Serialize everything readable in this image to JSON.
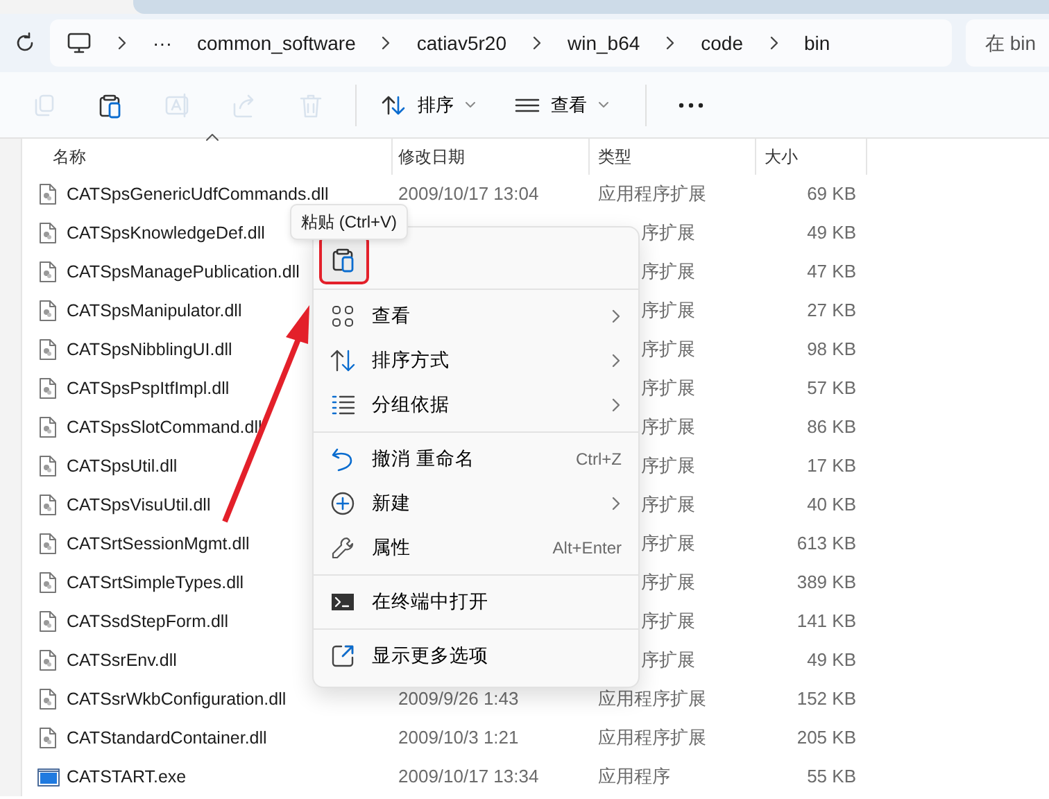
{
  "address_bar": {
    "overflow": "···",
    "segments": [
      "common_software",
      "catiav5r20",
      "win_b64",
      "code",
      "bin"
    ]
  },
  "search": {
    "placeholder": "在 bin"
  },
  "toolbar": {
    "icon_buttons": [
      {
        "kind": "copy",
        "disabled": true
      },
      {
        "kind": "paste",
        "disabled": false
      },
      {
        "kind": "rename",
        "disabled": true
      },
      {
        "kind": "share",
        "disabled": true
      },
      {
        "kind": "delete",
        "disabled": true
      }
    ],
    "sort": "排序",
    "view": "查看"
  },
  "columns": [
    {
      "label": "名称",
      "sorted": true
    },
    {
      "label": "修改日期",
      "sorted": false
    },
    {
      "label": "类型",
      "sorted": false
    },
    {
      "label": "大小",
      "sorted": false
    }
  ],
  "rows": [
    {
      "kind": "dll",
      "name": "CATSpsGenericUdfCommands.dll",
      "date": "2009/10/17 13:04",
      "type": "应用程序扩展",
      "size": "69 KB"
    },
    {
      "kind": "dll",
      "name": "CATSpsKnowledgeDef.dll",
      "type": "序扩展",
      "size": "49 KB"
    },
    {
      "kind": "dll",
      "name": "CATSpsManagePublication.dll",
      "type": "序扩展",
      "size": "47 KB"
    },
    {
      "kind": "dll",
      "name": "CATSpsManipulator.dll",
      "type": "序扩展",
      "size": "27 KB"
    },
    {
      "kind": "dll",
      "name": "CATSpsNibblingUI.dll",
      "type": "序扩展",
      "size": "98 KB"
    },
    {
      "kind": "dll",
      "name": "CATSpsPspItfImpl.dll",
      "type": "序扩展",
      "size": "57 KB"
    },
    {
      "kind": "dll",
      "name": "CATSpsSlotCommand.dll",
      "type": "序扩展",
      "size": "86 KB"
    },
    {
      "kind": "dll",
      "name": "CATSpsUtil.dll",
      "type": "序扩展",
      "size": "17 KB"
    },
    {
      "kind": "dll",
      "name": "CATSpsVisuUtil.dll",
      "type": "序扩展",
      "size": "40 KB"
    },
    {
      "kind": "dll",
      "name": "CATSrtSessionMgmt.dll",
      "type": "序扩展",
      "size": "613 KB"
    },
    {
      "kind": "dll",
      "name": "CATSrtSimpleTypes.dll",
      "type": "序扩展",
      "size": "389 KB"
    },
    {
      "kind": "dll",
      "name": "CATSsdStepForm.dll",
      "type": "序扩展",
      "size": "141 KB"
    },
    {
      "kind": "dll",
      "name": "CATSsrEnv.dll",
      "type": "序扩展",
      "size": "49 KB"
    },
    {
      "kind": "dll",
      "name": "CATSsrWkbConfiguration.dll",
      "date": "2009/9/26 1:43",
      "type": "应用程序扩展",
      "size": "152 KB"
    },
    {
      "kind": "dll",
      "name": "CATStandardContainer.dll",
      "date": "2009/10/3 1:21",
      "type": "应用程序扩展",
      "size": "205 KB"
    },
    {
      "kind": "exe",
      "name": "CATSTART.exe",
      "date": "2009/10/17 13:34",
      "type": "应用程序",
      "size": "55 KB"
    }
  ],
  "context_menu": {
    "tooltip": "粘贴 (Ctrl+V)",
    "top_icons": [
      {
        "kind": "paste",
        "annotated": true
      }
    ],
    "sections": [
      [
        {
          "label": "查看",
          "submenu": true
        },
        {
          "label": "排序方式",
          "submenu": true
        },
        {
          "label": "分组依据",
          "submenu": true
        }
      ],
      [
        {
          "label": "撤消 重命名",
          "shortcut": "Ctrl+Z",
          "submenu": false
        },
        {
          "label": "新建",
          "submenu": true
        },
        {
          "label": "属性",
          "shortcut": "Alt+Enter",
          "submenu": false
        }
      ],
      [
        {
          "label": "在终端中打开",
          "submenu": false
        }
      ],
      [
        {
          "label": "显示更多选项",
          "submenu": false
        }
      ]
    ]
  }
}
